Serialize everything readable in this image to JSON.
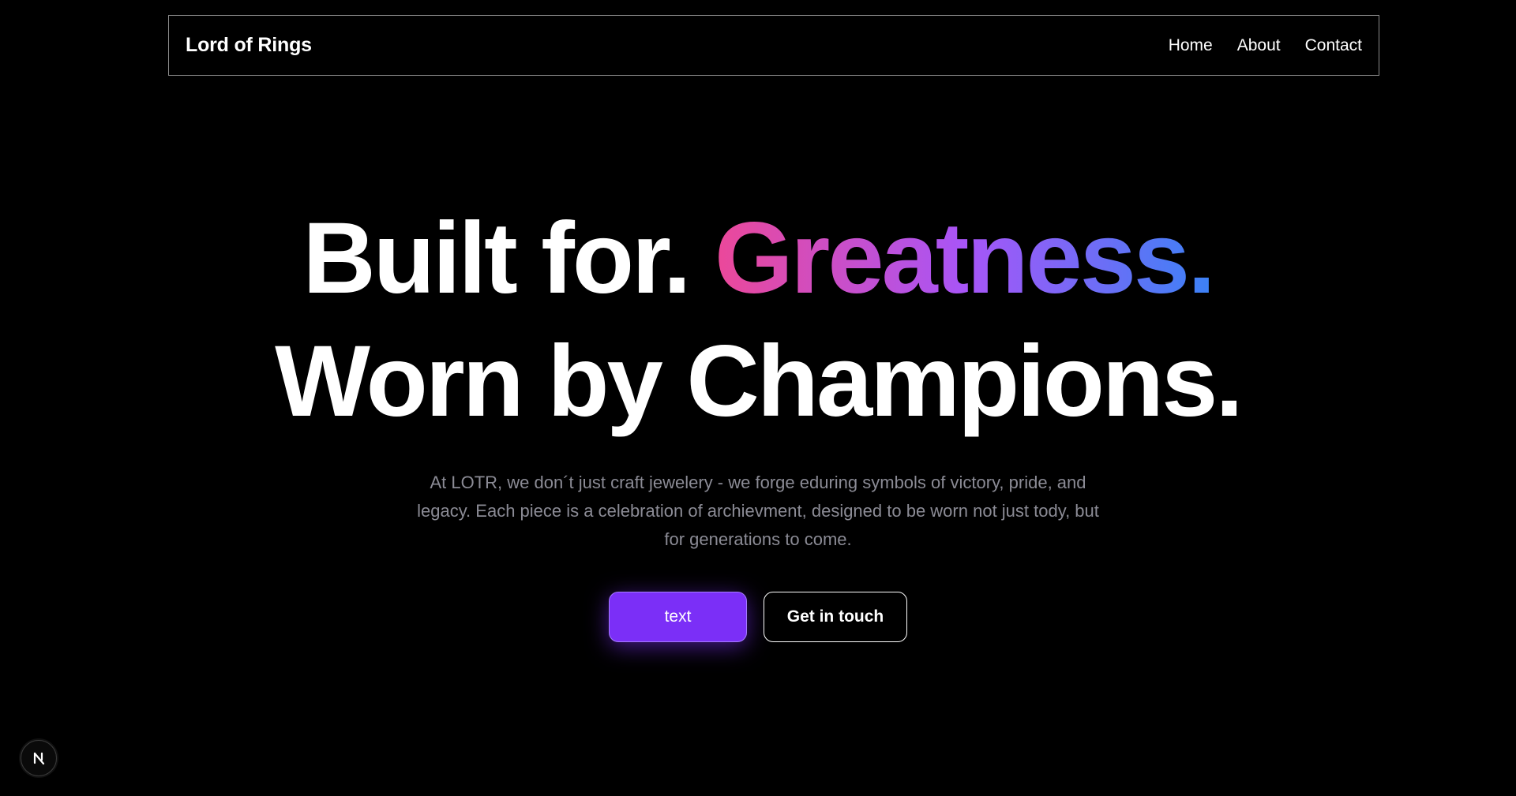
{
  "navbar": {
    "brand": "Lord of Rings",
    "links": [
      {
        "label": "Home"
      },
      {
        "label": "About"
      },
      {
        "label": "Contact"
      }
    ]
  },
  "hero": {
    "line1_plain": "Built for.",
    "line1_gradient": "Greatness.",
    "line2": "Worn by Champions.",
    "description": "At LOTR, we don´t just craft jewelery - we forge eduring symbols of victory, pride, and legacy. Each piece is a celebration of archievment, designed to be worn not just tody, but for generations to come.",
    "primary_button": "text",
    "secondary_button": "Get in touch"
  },
  "colors": {
    "background": "#000000",
    "gradient_start": "#ec4899",
    "gradient_mid": "#a855f7",
    "gradient_end": "#3b82f6",
    "primary_button": "#7b2ff7",
    "description_text": "#8b8b95"
  },
  "dev_badge": {
    "icon": "nextjs-logo-icon"
  }
}
